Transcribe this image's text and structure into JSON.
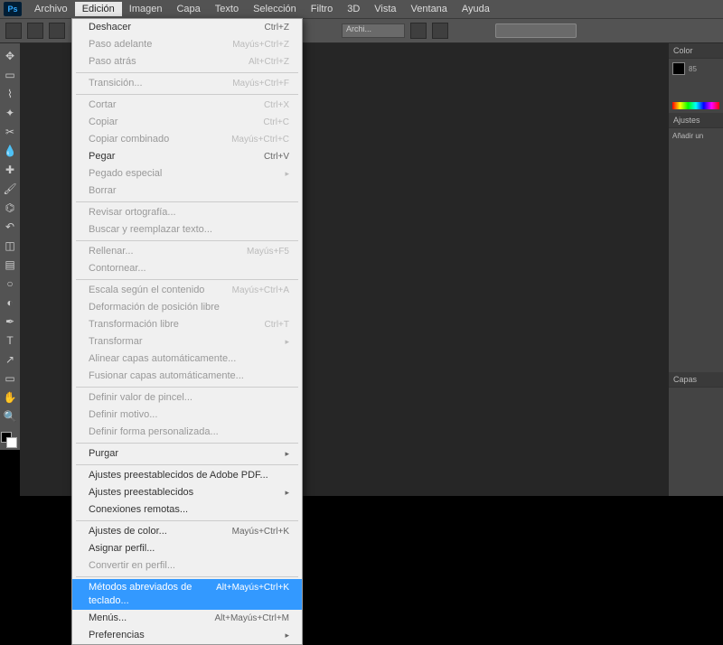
{
  "logo": "Ps",
  "menu": [
    "Archivo",
    "Edición",
    "Imagen",
    "Capa",
    "Texto",
    "Selección",
    "Filtro",
    "3D",
    "Vista",
    "Ventana",
    "Ayuda"
  ],
  "menu_active_index": 1,
  "dropdown": {
    "groups": [
      [
        {
          "label": "Deshacer",
          "shortcut": "Ctrl+Z",
          "disabled": false
        },
        {
          "label": "Paso adelante",
          "shortcut": "Mayús+Ctrl+Z",
          "disabled": true
        },
        {
          "label": "Paso atrás",
          "shortcut": "Alt+Ctrl+Z",
          "disabled": true
        }
      ],
      [
        {
          "label": "Transición...",
          "shortcut": "Mayús+Ctrl+F",
          "disabled": true
        }
      ],
      [
        {
          "label": "Cortar",
          "shortcut": "Ctrl+X",
          "disabled": true
        },
        {
          "label": "Copiar",
          "shortcut": "Ctrl+C",
          "disabled": true
        },
        {
          "label": "Copiar combinado",
          "shortcut": "Mayús+Ctrl+C",
          "disabled": true
        },
        {
          "label": "Pegar",
          "shortcut": "Ctrl+V",
          "disabled": false
        },
        {
          "label": "Pegado especial",
          "shortcut": "",
          "disabled": true,
          "arrow": true
        },
        {
          "label": "Borrar",
          "shortcut": "",
          "disabled": true
        }
      ],
      [
        {
          "label": "Revisar ortografía...",
          "shortcut": "",
          "disabled": true
        },
        {
          "label": "Buscar y reemplazar texto...",
          "shortcut": "",
          "disabled": true
        }
      ],
      [
        {
          "label": "Rellenar...",
          "shortcut": "Mayús+F5",
          "disabled": true
        },
        {
          "label": "Contornear...",
          "shortcut": "",
          "disabled": true
        }
      ],
      [
        {
          "label": "Escala según el contenido",
          "shortcut": "Mayús+Ctrl+A",
          "disabled": true
        },
        {
          "label": "Deformación de posición libre",
          "shortcut": "",
          "disabled": true
        },
        {
          "label": "Transformación libre",
          "shortcut": "Ctrl+T",
          "disabled": true
        },
        {
          "label": "Transformar",
          "shortcut": "",
          "disabled": true,
          "arrow": true
        },
        {
          "label": "Alinear capas automáticamente...",
          "shortcut": "",
          "disabled": true
        },
        {
          "label": "Fusionar capas automáticamente...",
          "shortcut": "",
          "disabled": true
        }
      ],
      [
        {
          "label": "Definir valor de pincel...",
          "shortcut": "",
          "disabled": true
        },
        {
          "label": "Definir motivo...",
          "shortcut": "",
          "disabled": true
        },
        {
          "label": "Definir forma personalizada...",
          "shortcut": "",
          "disabled": true
        }
      ],
      [
        {
          "label": "Purgar",
          "shortcut": "",
          "disabled": false,
          "arrow": true
        }
      ],
      [
        {
          "label": "Ajustes preestablecidos de Adobe PDF...",
          "shortcut": "",
          "disabled": false
        },
        {
          "label": "Ajustes preestablecidos",
          "shortcut": "",
          "disabled": false,
          "arrow": true
        },
        {
          "label": "Conexiones remotas...",
          "shortcut": "",
          "disabled": false
        }
      ],
      [
        {
          "label": "Ajustes de color...",
          "shortcut": "Mayús+Ctrl+K",
          "disabled": false
        },
        {
          "label": "Asignar perfil...",
          "shortcut": "",
          "disabled": false
        },
        {
          "label": "Convertir en perfil...",
          "shortcut": "",
          "disabled": true
        }
      ],
      [
        {
          "label": "Métodos abreviados de teclado...",
          "shortcut": "Alt+Mayús+Ctrl+K",
          "disabled": false,
          "hl": true
        },
        {
          "label": "Menús...",
          "shortcut": "Alt+Mayús+Ctrl+M",
          "disabled": false
        },
        {
          "label": "Preferencias",
          "shortcut": "",
          "disabled": false,
          "arrow": true
        }
      ]
    ]
  },
  "optbar": {
    "field1": "Archi...",
    "btn": ""
  },
  "tools": [
    "move",
    "marquee",
    "lasso",
    "wand",
    "crop",
    "eyedropper",
    "heal",
    "brush",
    "stamp",
    "history",
    "eraser",
    "gradient",
    "blur",
    "dodge",
    "pen",
    "type",
    "path",
    "rect",
    "hand",
    "zoom"
  ],
  "right": {
    "color_tab": "Color",
    "adjust_tab": "Ajustes",
    "adjust_text": "Añadir un",
    "layers_tab": "Capas",
    "value": "85"
  }
}
